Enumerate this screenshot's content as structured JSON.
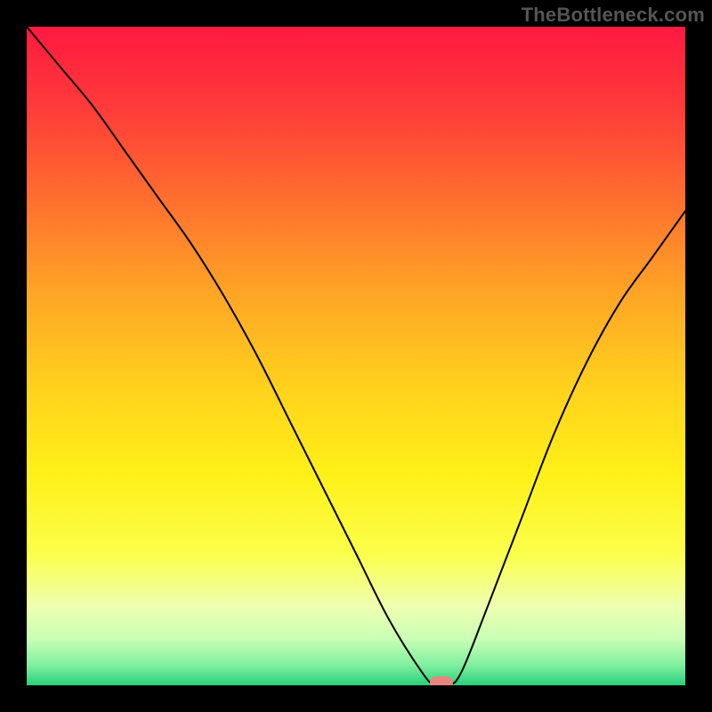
{
  "watermark": "TheBottleneck.com",
  "chart_data": {
    "type": "line",
    "title": "",
    "xlabel": "",
    "ylabel": "",
    "xlim": [
      0,
      100
    ],
    "ylim": [
      0,
      100
    ],
    "grid": false,
    "series": [
      {
        "name": "bottleneck-curve",
        "x": [
          0,
          5,
          10,
          15,
          20,
          25,
          30,
          35,
          40,
          45,
          50,
          55,
          60,
          62,
          64,
          66,
          70,
          75,
          80,
          85,
          90,
          95,
          100
        ],
        "values": [
          100,
          94,
          88,
          81,
          74,
          67,
          59,
          50,
          40,
          30,
          20,
          10,
          2,
          0,
          0,
          2,
          12,
          25,
          38,
          49,
          58,
          65,
          72
        ]
      }
    ],
    "marker": {
      "x": 63,
      "y": 0,
      "color": "#e9857d"
    },
    "background_gradient": {
      "stops": [
        {
          "pos": 0.0,
          "color": "#ff1940"
        },
        {
          "pos": 0.12,
          "color": "#ff3a3a"
        },
        {
          "pos": 0.25,
          "color": "#ff6a2f"
        },
        {
          "pos": 0.4,
          "color": "#ffa326"
        },
        {
          "pos": 0.55,
          "color": "#ffd21c"
        },
        {
          "pos": 0.68,
          "color": "#fff018"
        },
        {
          "pos": 0.8,
          "color": "#fbff4a"
        },
        {
          "pos": 0.88,
          "color": "#efffb0"
        },
        {
          "pos": 0.93,
          "color": "#c8ffb5"
        },
        {
          "pos": 0.97,
          "color": "#7eef9e"
        },
        {
          "pos": 1.0,
          "color": "#26d07c"
        }
      ]
    },
    "curve_color": "#000000",
    "curve_width": 2
  }
}
